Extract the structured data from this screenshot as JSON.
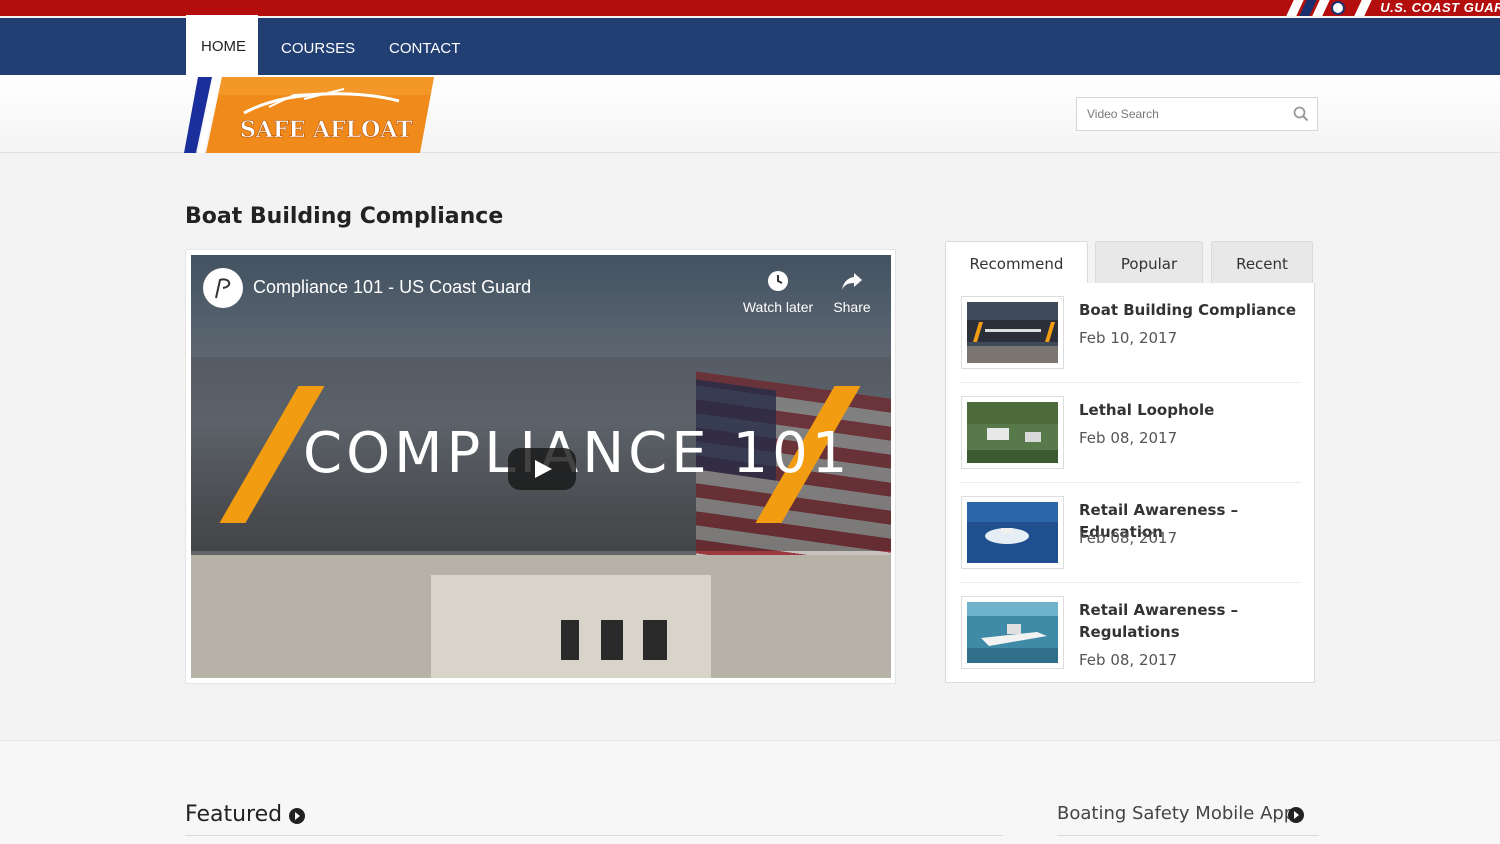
{
  "brand": {
    "top_banner_text": "U.S. COAST GUAR",
    "logo_text": "SAFE AFLOAT",
    "colors": {
      "nav_blue": "#213f73",
      "banner_red": "#b30d0d",
      "accent_orange": "#f29c11"
    }
  },
  "nav": {
    "items": [
      {
        "label": "HOME",
        "active": true
      },
      {
        "label": "COURSES",
        "active": false
      },
      {
        "label": "CONTACT",
        "active": false
      }
    ]
  },
  "search": {
    "placeholder": "Video Search",
    "icon": "search-icon"
  },
  "main": {
    "page_title": "Boat Building Compliance",
    "video": {
      "title": "Compliance 101 - US Coast Guard",
      "overlay_text": "COMPLIANCE 101",
      "watch_later_label": "Watch later",
      "share_label": "Share",
      "icons": [
        "clock-icon",
        "share-arrow-icon",
        "play-icon"
      ]
    }
  },
  "sidebar": {
    "tabs": [
      {
        "label": "Recommend",
        "active": true
      },
      {
        "label": "Popular",
        "active": false
      },
      {
        "label": "Recent",
        "active": false
      }
    ],
    "items": [
      {
        "title": "Boat Building Compliance",
        "date": "Feb 10, 2017"
      },
      {
        "title": "Lethal Loophole",
        "date": "Feb 08, 2017"
      },
      {
        "title": "Retail Awareness – Education",
        "date": "Feb 08, 2017"
      },
      {
        "title": "Retail Awareness – Regulations",
        "date": "Feb 08, 2017"
      }
    ]
  },
  "lower": {
    "featured_label": "Featured",
    "app_label": "Boating Safety Mobile App"
  }
}
